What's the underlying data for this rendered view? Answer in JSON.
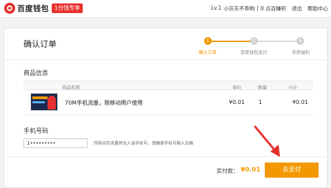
{
  "brand": {
    "name": "百度钱包",
    "promo": "1分钱专享"
  },
  "user_nav": {
    "level": "Lv.1",
    "username": "小灰灰不乖哟",
    "points": "0 点百赚积",
    "logout": "退出",
    "help": "帮助中心"
  },
  "page": {
    "title": "确认订单"
  },
  "steps": [
    {
      "num": "1",
      "label": "确认订单",
      "active": true
    },
    {
      "num": "2",
      "label": "百度钱包支付",
      "active": false
    },
    {
      "num": "3",
      "label": "享用福利",
      "active": false
    }
  ],
  "product_section": {
    "title": "商品信息",
    "headers": {
      "name": "商品名称",
      "price": "单价",
      "qty": "数量",
      "subtotal": "小计"
    },
    "row": {
      "name": "70M手机流量，限移动用户使用",
      "price": "¥0.01",
      "qty": "1",
      "subtotal": "¥0.01"
    }
  },
  "phone_section": {
    "title": "手机号码",
    "value": "1•••••••••",
    "hint": "所购买的流量将充入该手机号，请确保手机号输入正确"
  },
  "total": {
    "label": "实付款：",
    "amount": "¥0.01"
  },
  "submit_label": "去支付",
  "colors": {
    "accent": "#f39800",
    "brand": "#e7312e"
  }
}
